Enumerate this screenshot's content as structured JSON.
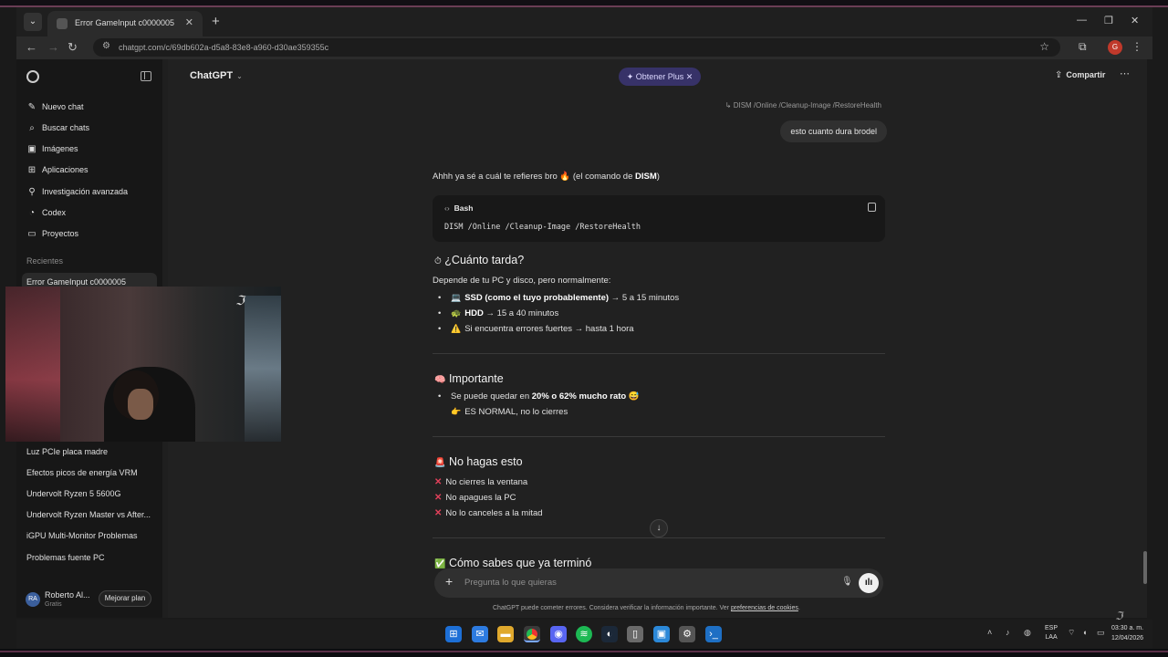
{
  "browser": {
    "tab_title": "Error GameInput c0000005",
    "url": "chatgpt.com/c/69db602a-d5a8-83e8-a960-d30ae359355c",
    "profile_initial": "G"
  },
  "sidebar": {
    "items": [
      {
        "icon": "edit-icon",
        "label": "Nuevo chat"
      },
      {
        "icon": "search-icon",
        "label": "Buscar chats"
      },
      {
        "icon": "image-icon",
        "label": "Imágenes"
      },
      {
        "icon": "apps-icon",
        "label": "Aplicaciones"
      },
      {
        "icon": "research-icon",
        "label": "Investigación avanzada"
      },
      {
        "icon": "codex-icon",
        "label": "Codex"
      },
      {
        "icon": "folder-icon",
        "label": "Proyectos"
      }
    ],
    "section_label": "Recientes",
    "recents": [
      "Error GameInput c0000005",
      "Luz PCIe placa madre",
      "Efectos picos de energía VRM",
      "Undervolt Ryzen 5 5600G",
      "Undervolt Ryzen Master vs After...",
      "iGPU Multi-Monitor Problemas",
      "Problemas fuente PC"
    ],
    "user": {
      "initials": "RA",
      "name": "Roberto Al...",
      "plan": "Gratis",
      "upgrade_label": "Mejorar plan"
    }
  },
  "header": {
    "model": "ChatGPT",
    "plus_label": "Obtener Plus",
    "share_label": "Compartir"
  },
  "chat": {
    "prev_command": "DISM /Online /Cleanup-Image /RestoreHealth",
    "user_message": "esto cuanto dura brodel",
    "intro_a": "Ahhh ya sé a cuál te refieres bro 🔥 (el comando de ",
    "intro_b": "DISM",
    "intro_c": ")",
    "code_lang": "Bash",
    "code_cmd": "DISM /Online /Cleanup-Image /RestoreHealth",
    "h1": "¿Cuánto tarda?",
    "h1_emoji": "⏱",
    "p1": "Depende de tu PC y disco, pero normalmente:",
    "b1_bold": "SSD (como el tuyo probablemente)",
    "b1_rest": " → 5 a 15 minutos",
    "b1_emoji": "💻",
    "b2_bold": "HDD",
    "b2_rest": " → 15 a 40 minutos",
    "b2_emoji": "🐢",
    "b3_text": "Si encuentra errores fuertes → hasta 1 hora",
    "b3_emoji": "⚠️",
    "h2": "Importante",
    "h2_emoji": "🧠",
    "i1_a": "Se puede quedar en ",
    "i1_b": "20% o 62% mucho rato",
    "i1_emoji": "😅",
    "i2_emoji": "👉",
    "i2_text": "ES NORMAL, no lo cierres",
    "h3": "No hagas esto",
    "h3_emoji": "🚨",
    "x1": "No cierres la ventana",
    "x2": "No apagues la PC",
    "x3": "No lo canceles a la mitad",
    "h4": "Cómo sabes que ya terminó",
    "h4_emoji": "✅"
  },
  "composer": {
    "placeholder": "Pregunta lo que quieras",
    "disclaimer_a": "ChatGPT puede cometer errores. Considera verificar la información importante. Ver ",
    "disclaimer_link": "preferencias de cookies",
    "disclaimer_b": "."
  },
  "taskbar": {
    "lang_1": "ESP",
    "lang_2": "LAA",
    "time": "03:30 a. m.",
    "date": "12/04/2026"
  }
}
